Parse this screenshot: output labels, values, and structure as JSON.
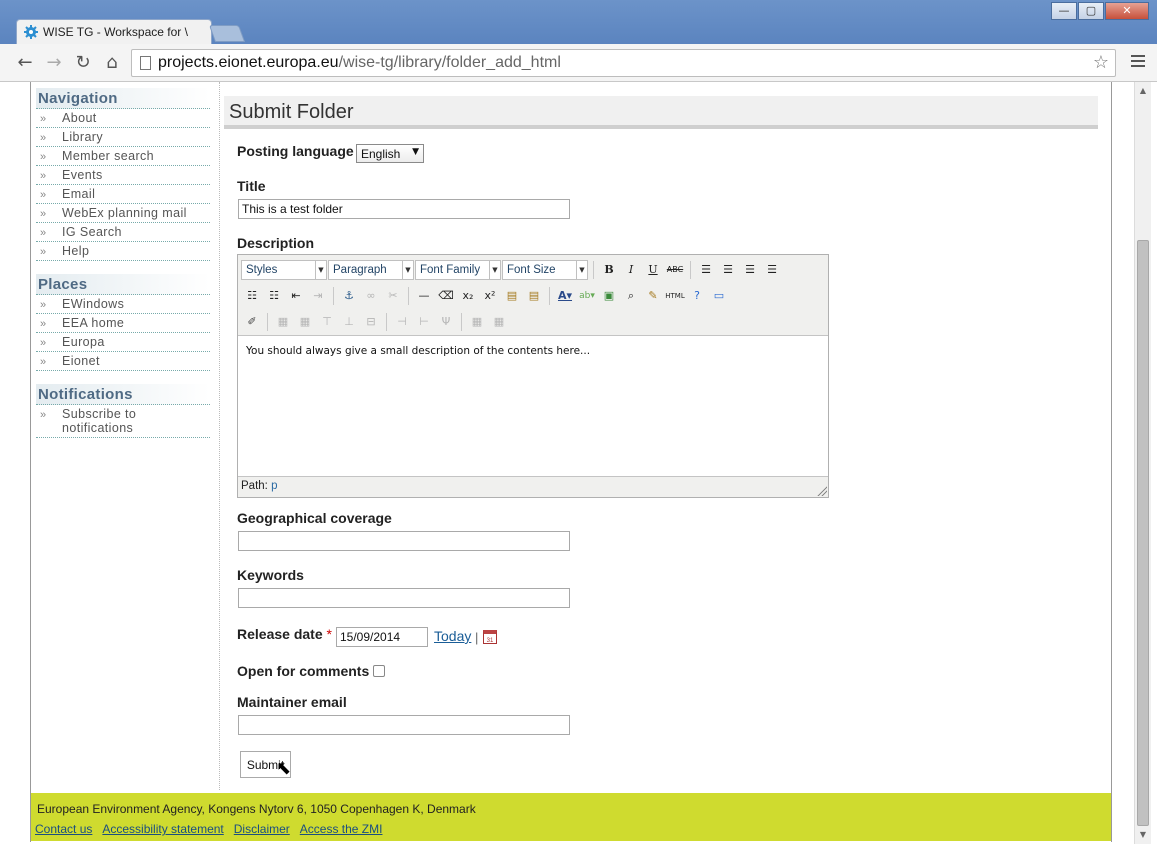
{
  "browser": {
    "tab_title": "WISE TG - Workspace for \\",
    "url_host": "projects.eionet.europa.eu",
    "url_path": "/wise-tg/library/folder_add_html",
    "win_minimize": "—",
    "win_maximize": "▢",
    "win_close": "✕",
    "back_icon": "←",
    "forward_icon": "→",
    "reload_icon": "↻",
    "home_icon": "⌂",
    "star_icon": "☆"
  },
  "sidebar": {
    "navigation": {
      "heading": "Navigation",
      "items": [
        "About",
        "Library",
        "Member search",
        "Events",
        "Email",
        "WebEx planning mail",
        "IG Search",
        "Help"
      ]
    },
    "places": {
      "heading": "Places",
      "items": [
        "EWindows",
        "EEA home",
        "Europa",
        "Eionet"
      ]
    },
    "notifications": {
      "heading": "Notifications",
      "items": [
        "Subscribe to notifications"
      ]
    },
    "bullet": "»"
  },
  "page": {
    "title": "Submit Folder"
  },
  "form": {
    "posting_language_label": "Posting language",
    "posting_language_value": "English",
    "title_label": "Title",
    "title_value": "This is a test folder",
    "description_label": "Description",
    "editor": {
      "styles": "Styles",
      "paragraph": "Paragraph",
      "font_family": "Font Family",
      "font_size": "Font Size",
      "content": "You should always give a small description of the contents here...",
      "path_label": "Path:",
      "path_value": "p"
    },
    "geo_label": "Geographical coverage",
    "geo_value": "",
    "keywords_label": "Keywords",
    "keywords_value": "",
    "release_date_label": "Release date",
    "required_mark": "*",
    "release_date_value": "15/09/2014",
    "today_link": "Today",
    "separator": "|",
    "open_comments_label": "Open for comments",
    "open_comments_checked": false,
    "maintainer_label": "Maintainer email",
    "maintainer_value": "",
    "submit_label": "Submit"
  },
  "footer": {
    "address": "European Environment Agency, Kongens Nytorv 6, 1050 Copenhagen K, Denmark",
    "links": [
      "Contact us",
      "Accessibility statement",
      "Disclaimer",
      "Access the ZMI"
    ]
  }
}
